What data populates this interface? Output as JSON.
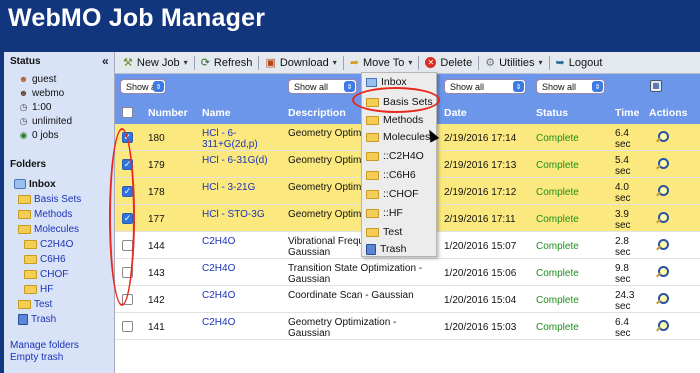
{
  "app": {
    "title": "WebMO Job Manager"
  },
  "sidebar": {
    "collapse_label": "«",
    "status_heading": "Status",
    "status": [
      {
        "icon": "user-icon",
        "text": "guest"
      },
      {
        "icon": "server-icon",
        "text": "webmo"
      },
      {
        "icon": "clock-icon",
        "text": "1:00"
      },
      {
        "icon": "clock-icon",
        "text": "unlimited"
      },
      {
        "icon": "jobs-icon",
        "text": "0 jobs"
      }
    ],
    "folders_heading": "Folders",
    "folders": [
      {
        "label": "Inbox",
        "level": 0
      },
      {
        "label": "Basis Sets",
        "level": 1
      },
      {
        "label": "Methods",
        "level": 1
      },
      {
        "label": "Molecules",
        "level": 1
      },
      {
        "label": "C2H4O",
        "level": 2
      },
      {
        "label": "C6H6",
        "level": 2
      },
      {
        "label": "CHOF",
        "level": 2
      },
      {
        "label": "HF",
        "level": 2
      },
      {
        "label": "Test",
        "level": 1
      },
      {
        "label": "Trash",
        "level": 1
      }
    ],
    "manage_folders": "Manage folders",
    "empty_trash": "Empty trash"
  },
  "toolbar": {
    "new_job": "New Job",
    "refresh": "Refresh",
    "download": "Download",
    "move_to": "Move To",
    "delete": "Delete",
    "utilities": "Utilities",
    "logout": "Logout"
  },
  "filters": {
    "number": "Show all",
    "description": "Show all",
    "date": "Show all",
    "status": "Show all"
  },
  "table": {
    "headers": {
      "number": "Number",
      "name": "Name",
      "description": "Description",
      "date": "Date",
      "status": "Status",
      "time": "Time",
      "actions": "Actions"
    },
    "rows": [
      {
        "checked": true,
        "number": "180",
        "name": "HCl - 6-\n311+G(2d,p)",
        "description": "Geometry Optimiz",
        "date": "2/19/2016 17:14",
        "status": "Complete",
        "time": "6.4\nsec"
      },
      {
        "checked": true,
        "number": "179",
        "name": "HCl - 6-31G(d)",
        "description": "Geometry Optimiz",
        "date": "2/19/2016 17:13",
        "status": "Complete",
        "time": "5.4\nsec"
      },
      {
        "checked": true,
        "number": "178",
        "name": "HCl - 3-21G",
        "description": "Geometry Optimiz",
        "date": "2/19/2016 17:12",
        "status": "Complete",
        "time": "4.0\nsec"
      },
      {
        "checked": true,
        "number": "177",
        "name": "HCl - STO-3G",
        "description": "Geometry Optimiz",
        "date": "2/19/2016 17:11",
        "status": "Complete",
        "time": "3.9\nsec"
      },
      {
        "checked": false,
        "number": "144",
        "name": "C2H4O",
        "description": "Vibrational Frequencies -\nGaussian",
        "date": "1/20/2016 15:07",
        "status": "Complete",
        "time": "2.8\nsec"
      },
      {
        "checked": false,
        "number": "143",
        "name": "C2H4O",
        "description": "Transition State Optimization -\nGaussian",
        "date": "1/20/2016 15:06",
        "status": "Complete",
        "time": "9.8\nsec"
      },
      {
        "checked": false,
        "number": "142",
        "name": "C2H4O",
        "description": "Coordinate Scan - Gaussian",
        "date": "1/20/2016 15:04",
        "status": "Complete",
        "time": "24.3\nsec"
      },
      {
        "checked": false,
        "number": "141",
        "name": "C2H4O",
        "description": "Geometry Optimization - Gaussian",
        "date": "1/20/2016 15:03",
        "status": "Complete",
        "time": "6.4\nsec"
      }
    ]
  },
  "move_menu": {
    "items": [
      "Inbox",
      "Basis Sets",
      "Methods",
      "Molecules",
      "::C2H4O",
      "::C6H6",
      "::CHOF",
      "::HF",
      "Test",
      "Trash"
    ]
  },
  "colors": {
    "brand_blue": "#12367e",
    "header_blue": "#6c96ea",
    "selected_row": "#fbe97f",
    "status_green": "#1c8f1c",
    "link_blue": "#1a33b8",
    "highlight_red": "#e8291f"
  }
}
